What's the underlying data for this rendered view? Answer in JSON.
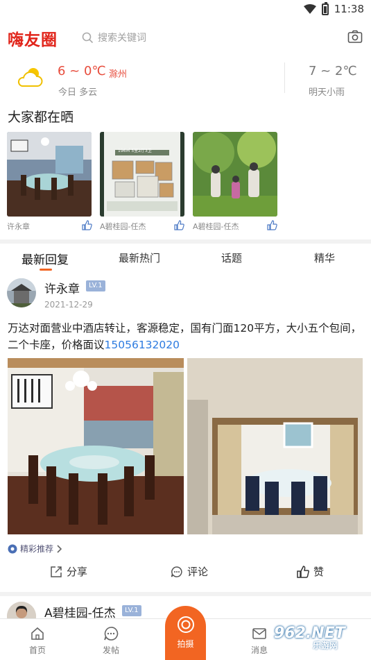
{
  "status": {
    "time": "11:38"
  },
  "header": {
    "logo": "嗨友圈",
    "search_placeholder": "搜索关键词"
  },
  "weather": {
    "today_temp": "6 ~ 0℃",
    "city": "滁州",
    "today_label": "今日 多云",
    "tomorrow_temp": "7 ~ 2℃",
    "tomorrow_label": "明天小雨"
  },
  "share": {
    "title": "大家都在晒",
    "items": [
      {
        "author": "许永章"
      },
      {
        "author": "A碧桂园-任杰",
        "ad_text": "196㎡  5室2厅3卫"
      },
      {
        "author": "A碧桂园-任杰"
      }
    ]
  },
  "tabs": [
    "最新回复",
    "最新热门",
    "话题",
    "精华"
  ],
  "post": {
    "user": "许永章",
    "level": "LV.1",
    "date": "2021-12-29",
    "text": "万达对面营业中酒店转让，客源稳定，国有门面120平方，大小五个包间，二个卡座，价格面议",
    "phone": "15056132020",
    "recommend": "精彩推荐",
    "actions": {
      "share": "分享",
      "comment": "评论",
      "like": "赞"
    }
  },
  "post2": {
    "user": "A碧桂园-任杰",
    "level": "LV.1"
  },
  "nav": {
    "home": "首页",
    "post": "发帖",
    "shoot": "拍摄",
    "message": "消息"
  },
  "watermark": {
    "brand": "962.NET",
    "site": "乐游网"
  },
  "colors": {
    "accent": "#f26522",
    "brand_red": "#e1251b",
    "link": "#2d7be0",
    "level_badge": "#9ab2d9"
  }
}
